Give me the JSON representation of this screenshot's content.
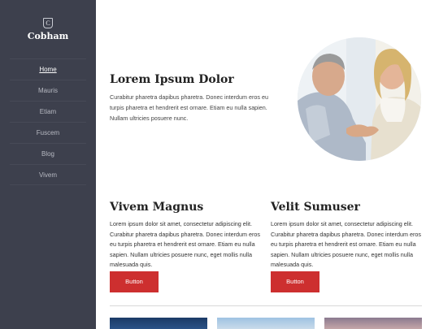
{
  "sidebar": {
    "logo_letter": "C",
    "brand": "Cobham",
    "nav": [
      {
        "label": "Home",
        "active": true
      },
      {
        "label": "Mauris"
      },
      {
        "label": "Etiam"
      },
      {
        "label": "Fuscem"
      },
      {
        "label": "Blog"
      },
      {
        "label": "Vivem"
      }
    ]
  },
  "hero": {
    "title": "Lorem Ipsum Dolor",
    "text": "Curabitur pharetra dapibus pharetra. Donec interdum eros eu turpis pharetra et hendrerit est ornare. Etiam eu nulla sapien. Nullam ultricies posuere nunc."
  },
  "columns": [
    {
      "title": "Vivem Magnus",
      "text": "Lorem ipsum dolor sit amet, consectetur adipiscing elit. Curabitur pharetra dapibus pharetra. Donec interdum eros eu turpis pharetra et hendrerit est ornare. Etiam eu nulla sapien. Nullam ultricies posuere nunc, eget mollis nulla malesuada quis.",
      "button": "Button"
    },
    {
      "title": "Velit Sumuser",
      "text": "Lorem ipsum dolor sit amet, consectetur adipiscing elit. Curabitur pharetra dapibus pharetra. Donec interdum eros eu turpis pharetra et hendrerit est ornare. Etiam eu nulla sapien. Nullam ultricies posuere nunc, eget mollis nulla malesuada quis.",
      "button": "Button"
    }
  ],
  "colors": {
    "sidebar": "#3d404d",
    "accent": "#cd2f2f"
  },
  "images": [
    "couple-handshake-photo",
    "thumbnail-blue-landscape",
    "thumbnail-mountain-landscape",
    "thumbnail-dusk-landscape"
  ]
}
